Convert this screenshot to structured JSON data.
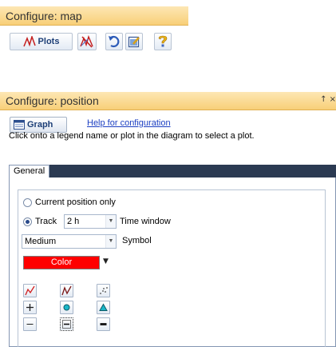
{
  "map_panel": {
    "title": "Configure: map",
    "toolbar": {
      "plots_label": "Plots",
      "icons": [
        "plots-icon",
        "delete-plot-icon",
        "undo-icon",
        "edit-icon",
        "help-icon"
      ]
    }
  },
  "position_panel": {
    "title": "Configure: position",
    "window_controls": "↑ ×",
    "graph_button_label": "Graph",
    "help_link": "Help for configuration",
    "instruction": "Click onto a legend name or plot in the diagram to select a plot.",
    "tabs": [
      {
        "label": "General",
        "active": true
      }
    ],
    "general": {
      "current_position_label": "Current position only",
      "current_position_selected": false,
      "track_label": "Track",
      "track_selected": true,
      "track_value": "2 h",
      "time_window_label": "Time window",
      "symbol_value": "Medium",
      "symbol_label": "Symbol",
      "color_label": "Color",
      "color_value": "#ff0000"
    },
    "style_buttons": [
      [
        "line-red-icon",
        "line-dark-icon",
        "dots-icon"
      ],
      [
        "plus-icon",
        "circle-icon",
        "triangle-icon"
      ],
      [
        "thin-dash-icon",
        "medium-dash-icon",
        "thick-dash-icon"
      ]
    ]
  }
}
